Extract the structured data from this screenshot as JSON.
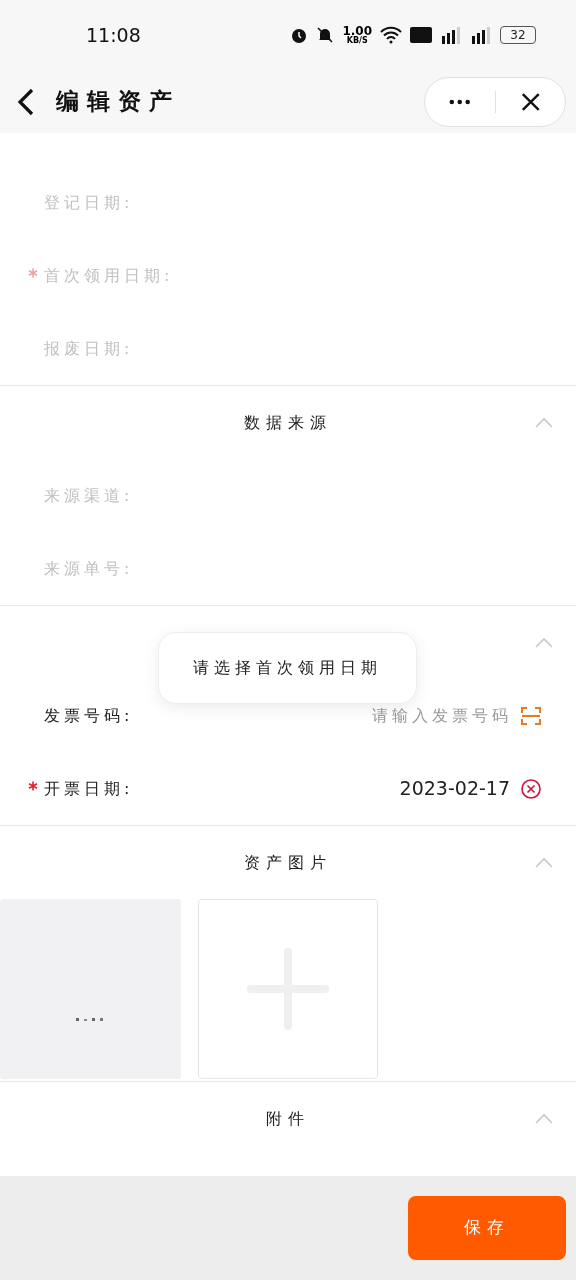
{
  "status_bar": {
    "time": "11:08",
    "speed": "1.00",
    "speed_unit": "KB/S",
    "battery": "32"
  },
  "header": {
    "title": "编辑资产"
  },
  "sections": [
    {
      "rows": [
        {
          "label": "登记日期:",
          "required": false,
          "disabled": true
        },
        {
          "label": "首次领用日期:",
          "required": true,
          "disabled": true
        },
        {
          "label": "报废日期:",
          "required": false,
          "disabled": true
        }
      ]
    },
    {
      "title": "数据来源",
      "expanded": true,
      "rows": [
        {
          "label": "来源渠道:",
          "required": false,
          "disabled": true
        },
        {
          "label": "来源单号:",
          "required": false,
          "disabled": true
        }
      ]
    },
    {
      "expanded": true,
      "rows": [
        {
          "label": "发票号码:",
          "required": false,
          "disabled": false,
          "placeholder": "请输入发票号码",
          "kind": "scan"
        },
        {
          "label": "开票日期:",
          "required": true,
          "disabled": false,
          "value": "2023-02-17",
          "kind": "clear"
        }
      ]
    },
    {
      "title": "资产图片",
      "expanded": true,
      "kind": "images"
    },
    {
      "title": "附件",
      "expanded": true
    }
  ],
  "toast": "请选择首次领用日期",
  "save_button": "保存"
}
